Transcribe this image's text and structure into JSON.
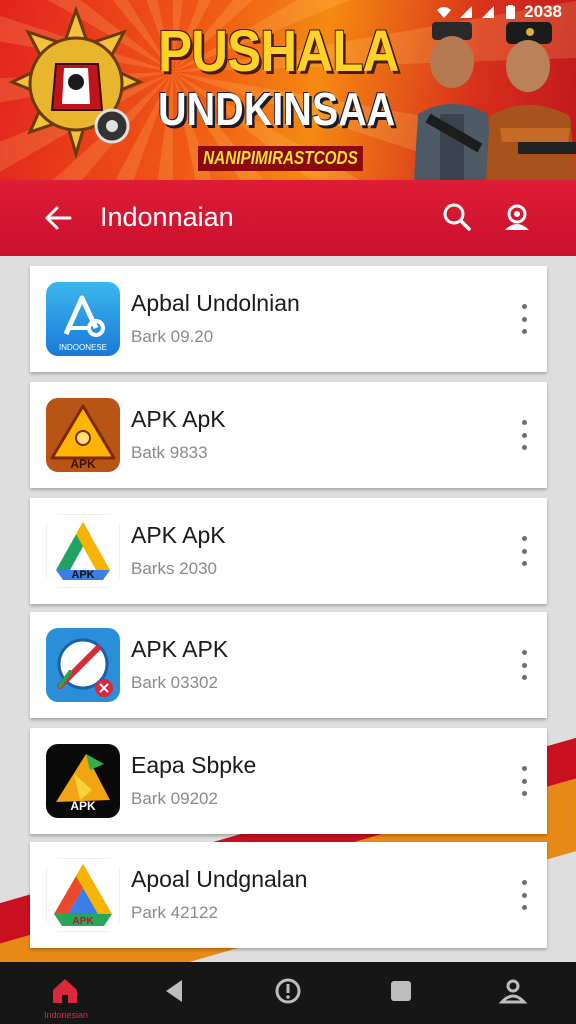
{
  "status_bar": {
    "time": "2038"
  },
  "banner": {
    "title_line1": "PUSHALA",
    "title_line2": "UNDKINSAA",
    "subtitle": "NANIPIMIRASTCODS"
  },
  "app_bar": {
    "title": "Indonnaian",
    "icons": [
      "back-arrow-icon",
      "search-icon",
      "user-icon"
    ]
  },
  "apps": [
    {
      "name": "Apbal Undolnian",
      "meta": "Bark 09.20",
      "icon": "blue-a-logo-icon",
      "icon_caption": "INDOONESE"
    },
    {
      "name": "APK ApK",
      "meta": "Batk 9833",
      "icon": "orange-triangle-apk-icon",
      "icon_caption": "APK"
    },
    {
      "name": "APK ApK",
      "meta": "Barks 2030",
      "icon": "green-drive-apk-icon",
      "icon_caption": "APK"
    },
    {
      "name": "APK APK",
      "meta": "Bark 03302",
      "icon": "compass-apk-icon",
      "icon_caption": ""
    },
    {
      "name": "Eapa Sbpke",
      "meta": "Bark 09202",
      "icon": "black-star-apk-icon",
      "icon_caption": "APK"
    },
    {
      "name": "Apoal Undgnalan",
      "meta": "Park 42122",
      "icon": "rainbow-drive-apk-icon",
      "icon_caption": "APK"
    }
  ],
  "bottom_nav": {
    "home_label": "Indonesian",
    "items": [
      "home-icon",
      "back-triangle-icon",
      "info-circle-icon",
      "recents-square-icon",
      "person-icon"
    ]
  },
  "colors": {
    "app_bar": "#c8102e",
    "banner_title": "#ffd22a",
    "bottom_nav": "#161616",
    "home_active": "#d82a3a"
  }
}
